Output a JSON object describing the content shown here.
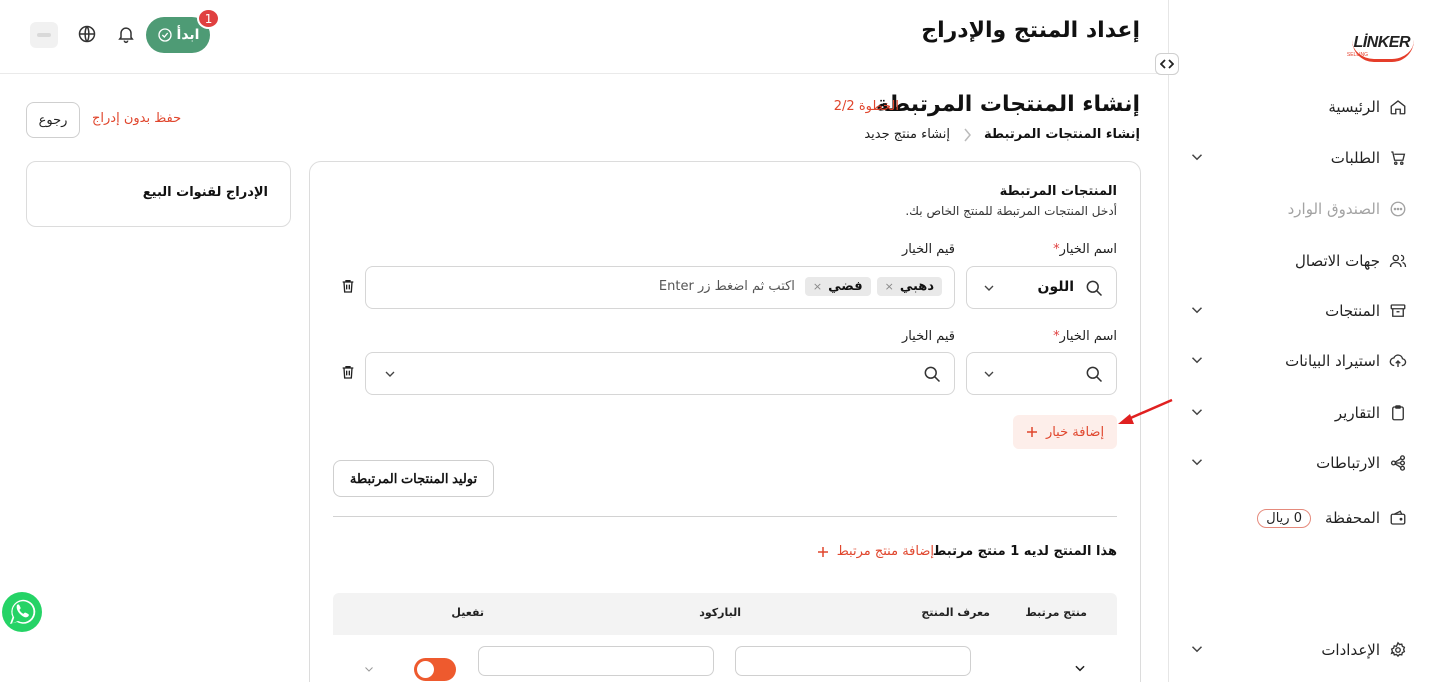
{
  "brand": {
    "logo_text": "LİNKER",
    "logo_sub": "SELLING"
  },
  "sidebar": {
    "items": [
      {
        "label": "الرئيسية",
        "icon": "home-icon",
        "has_chevron": false,
        "disabled": false
      },
      {
        "label": "الطلبات",
        "icon": "cart-icon",
        "has_chevron": true,
        "disabled": false
      },
      {
        "label": "الصندوق الوارد",
        "icon": "chat-icon",
        "has_chevron": false,
        "disabled": true
      },
      {
        "label": "جهات الاتصال",
        "icon": "users-icon",
        "has_chevron": false,
        "disabled": false
      },
      {
        "label": "المنتجات",
        "icon": "archive-icon",
        "has_chevron": true,
        "disabled": false
      },
      {
        "label": "استيراد البيانات",
        "icon": "cloud-upload-icon",
        "has_chevron": true,
        "disabled": false
      },
      {
        "label": "التقارير",
        "icon": "clipboard-icon",
        "has_chevron": true,
        "disabled": false
      },
      {
        "label": "الارتباطات",
        "icon": "integrations-icon",
        "has_chevron": true,
        "disabled": false
      },
      {
        "label": "المحفظة",
        "icon": "wallet-icon",
        "has_chevron": false,
        "disabled": false,
        "badge": "0 ريال"
      }
    ],
    "settings": {
      "label": "الإعدادات",
      "icon": "gear-icon"
    }
  },
  "header": {
    "title": "إعداد المنتج والإدراج",
    "start_label": "ابدأ",
    "notif_count": "1"
  },
  "page": {
    "title": "إنشاء المنتجات المرتبطة",
    "step": "الخطوة 2/2",
    "breadcrumb": {
      "parent": "إنشاء منتج جديد",
      "current": "إنشاء المنتجات المرتبطة"
    },
    "save_without_listing": "حفظ بدون إدراج",
    "back": "رجوع"
  },
  "side_card": {
    "title": "الإدراج لقنوات البيع"
  },
  "linked": {
    "title": "المنتجات المرتبطة",
    "subtitle": "أدخل المنتجات المرتبطة للمنتج الخاص بك.",
    "option_name_label": "اسم الخيار",
    "option_values_label": "قيم الخيار",
    "row1": {
      "option_name": "اللون",
      "chips": [
        "دهبي",
        "فضي"
      ],
      "placeholder": "اكتب ثم اضغط زر Enter"
    },
    "add_option": "إضافة خيار",
    "generate": "توليد المنتجات المرتبطة",
    "count_text": "هذا المنتج لديه 1 منتج مرتبط",
    "add_linked": "إضافة منتج مرتبط"
  },
  "table": {
    "headers": {
      "linked": "منتج مرتبط",
      "sku": "معرف المنتج",
      "barcode": "الباركود",
      "active": "تفعيل"
    }
  },
  "colors": {
    "accent": "#e0462d",
    "start_green": "#4e9b75",
    "toggle": "#ee5a2e"
  }
}
